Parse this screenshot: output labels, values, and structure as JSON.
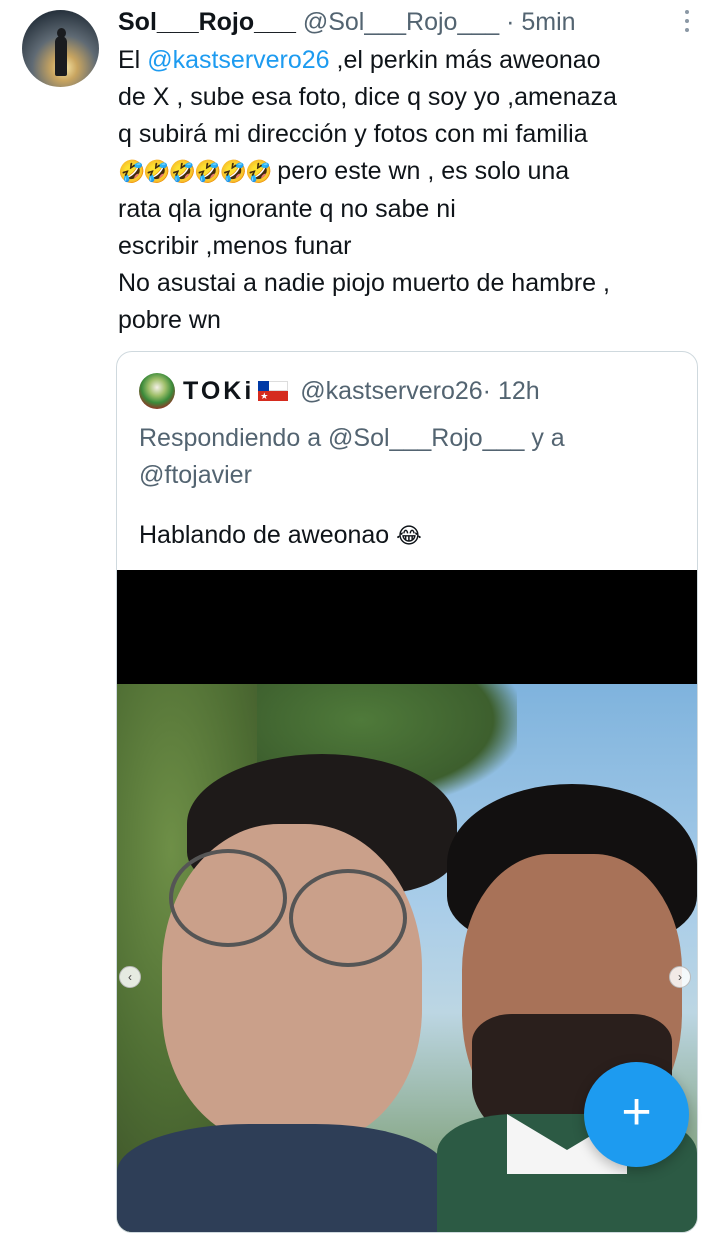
{
  "tweet": {
    "author_name": "Sol___Rojo___",
    "author_handle": "@Sol___Rojo___",
    "time": "· 5min",
    "lines": [
      {
        "pre": "El ",
        "mention": "@kastservero26",
        "post": " ,el perkin más aweonao"
      },
      {
        "text": "de X , sube esa foto, dice q soy yo ,amenaza"
      },
      {
        "text": "q subirá mi dirección y fotos con mi familia"
      },
      {
        "emoji": "🤣🤣🤣🤣🤣🤣",
        "text": " pero este wn , es solo una"
      },
      {
        "text": "rata qla ignorante q no sabe ni"
      },
      {
        "text": "escribir ,menos funar"
      },
      {
        "text": "No asustai a nadie piojo muerto de hambre ,"
      },
      {
        "text": "pobre wn"
      }
    ]
  },
  "quote": {
    "author_name": "TOKi",
    "flag": "🇨🇱",
    "author_handle": "@kastservero26",
    "time": "· 12h",
    "reply_line1": "Respondiendo a @Sol___Rojo___ y a",
    "reply_line2": "@ftojavier",
    "body_text": "Hablando de aweonao",
    "body_emoji": "😂"
  },
  "icons": {
    "more": "more-options-icon",
    "compose": "plus-icon",
    "carousel_prev": "chevron-left-icon",
    "carousel_next": "chevron-right-icon"
  },
  "fab_label": "+",
  "colors": {
    "accent": "#1d9bf0",
    "text": "#0f1419",
    "secondary": "#536471",
    "border": "#cfd9de"
  }
}
